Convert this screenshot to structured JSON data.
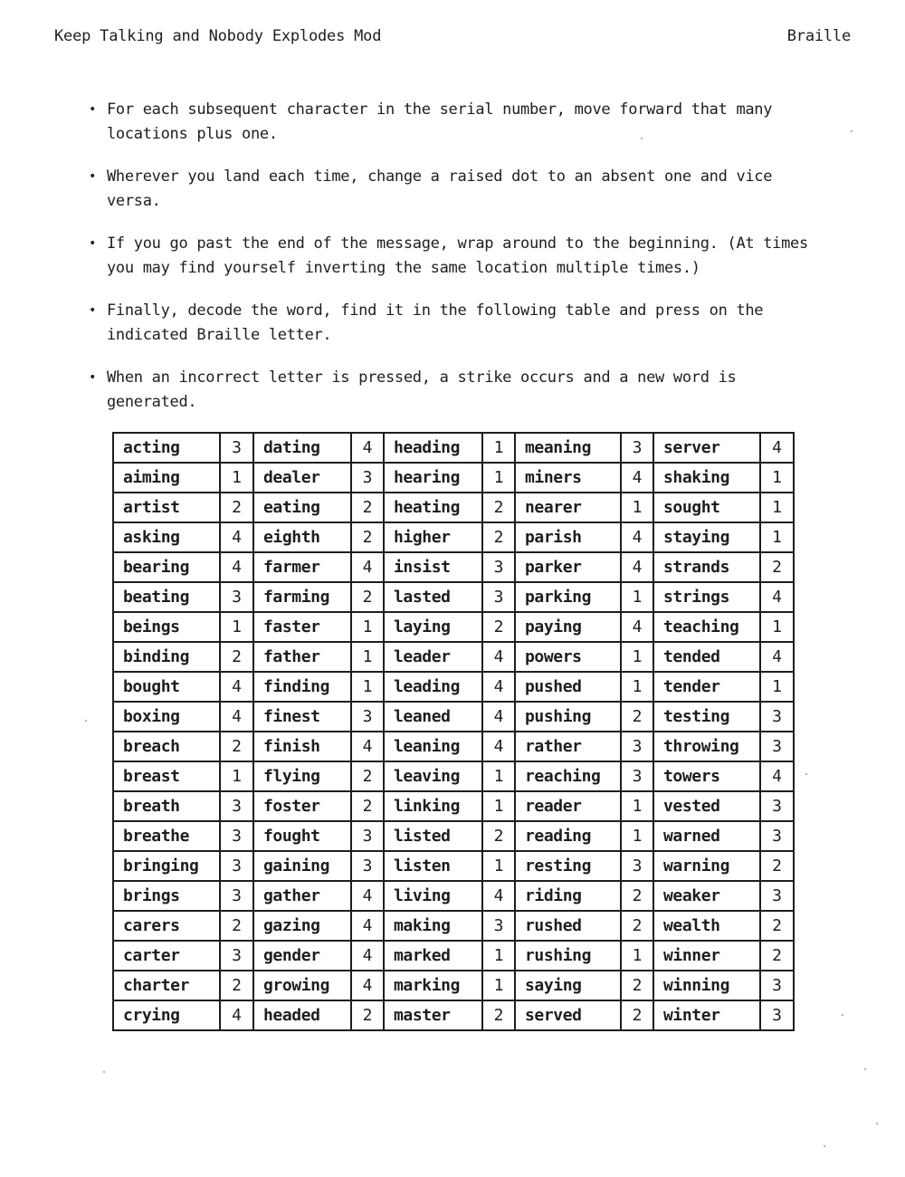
{
  "header": {
    "left": "Keep Talking and Nobody Explodes Mod",
    "right": "Braille"
  },
  "rules": [
    "For each subsequent character in the serial number, move forward that many locations plus one.",
    "Wherever you land each time, change a raised dot to an absent one and vice versa.",
    "If you go past the end of the message, wrap around to the beginning. (At times you may find yourself inverting the same location multiple times.)",
    "Finally, decode the word, find it in the following table and press on the indicated Braille letter.",
    "When an incorrect letter is pressed, a strike occurs and a new word is generated."
  ],
  "table": {
    "rows": [
      [
        "acting",
        "3",
        "dating",
        "4",
        "heading",
        "1",
        "meaning",
        "3",
        "server",
        "4"
      ],
      [
        "aiming",
        "1",
        "dealer",
        "3",
        "hearing",
        "1",
        "miners",
        "4",
        "shaking",
        "1"
      ],
      [
        "artist",
        "2",
        "eating",
        "2",
        "heating",
        "2",
        "nearer",
        "1",
        "sought",
        "1"
      ],
      [
        "asking",
        "4",
        "eighth",
        "2",
        "higher",
        "2",
        "parish",
        "4",
        "staying",
        "1"
      ],
      [
        "bearing",
        "4",
        "farmer",
        "4",
        "insist",
        "3",
        "parker",
        "4",
        "strands",
        "2"
      ],
      [
        "beating",
        "3",
        "farming",
        "2",
        "lasted",
        "3",
        "parking",
        "1",
        "strings",
        "4"
      ],
      [
        "beings",
        "1",
        "faster",
        "1",
        "laying",
        "2",
        "paying",
        "4",
        "teaching",
        "1"
      ],
      [
        "binding",
        "2",
        "father",
        "1",
        "leader",
        "4",
        "powers",
        "1",
        "tended",
        "4"
      ],
      [
        "bought",
        "4",
        "finding",
        "1",
        "leading",
        "4",
        "pushed",
        "1",
        "tender",
        "1"
      ],
      [
        "boxing",
        "4",
        "finest",
        "3",
        "leaned",
        "4",
        "pushing",
        "2",
        "testing",
        "3"
      ],
      [
        "breach",
        "2",
        "finish",
        "4",
        "leaning",
        "4",
        "rather",
        "3",
        "throwing",
        "3"
      ],
      [
        "breast",
        "1",
        "flying",
        "2",
        "leaving",
        "1",
        "reaching",
        "3",
        "towers",
        "4"
      ],
      [
        "breath",
        "3",
        "foster",
        "2",
        "linking",
        "1",
        "reader",
        "1",
        "vested",
        "3"
      ],
      [
        "breathe",
        "3",
        "fought",
        "3",
        "listed",
        "2",
        "reading",
        "1",
        "warned",
        "3"
      ],
      [
        "bringing",
        "3",
        "gaining",
        "3",
        "listen",
        "1",
        "resting",
        "3",
        "warning",
        "2"
      ],
      [
        "brings",
        "3",
        "gather",
        "4",
        "living",
        "4",
        "riding",
        "2",
        "weaker",
        "3"
      ],
      [
        "carers",
        "2",
        "gazing",
        "4",
        "making",
        "3",
        "rushed",
        "2",
        "wealth",
        "2"
      ],
      [
        "carter",
        "3",
        "gender",
        "4",
        "marked",
        "1",
        "rushing",
        "1",
        "winner",
        "2"
      ],
      [
        "charter",
        "2",
        "growing",
        "4",
        "marking",
        "1",
        "saying",
        "2",
        "winning",
        "3"
      ],
      [
        "crying",
        "4",
        "headed",
        "2",
        "master",
        "2",
        "served",
        "2",
        "winter",
        "3"
      ]
    ]
  }
}
